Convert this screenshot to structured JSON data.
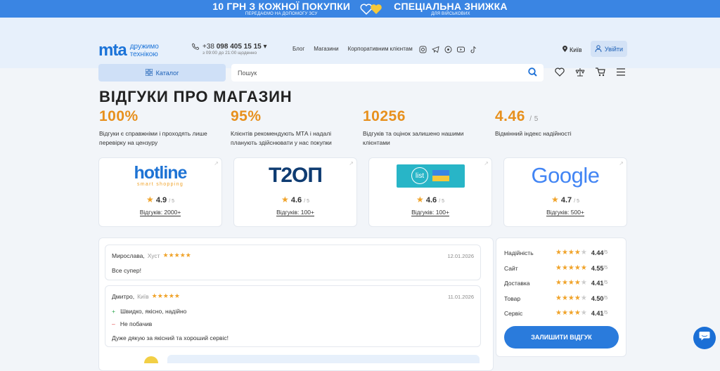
{
  "promo": {
    "left_title": "10 ГРН З КОЖНОЇ ПОКУПКИ",
    "left_sub": "ПЕРЕДАЄМО НА ДОПОМОГУ ЗСУ",
    "right_title": "СПЕЦІАЛЬНА ЗНИЖКА",
    "right_sub": "ДЛЯ ВІЙСЬКОВИХ",
    "colors": {
      "bg": "#3a85e3",
      "heart_blue": "#3a85e3",
      "heart_yellow": "#f5c83a"
    }
  },
  "header": {
    "logo_mark": "mta",
    "logo_tag_1": "дружимо",
    "logo_tag_2": "технікою",
    "phone_prefix": "+38",
    "phone_number": "098 405 15 15",
    "hours": "з 09:00 до 21:00 щоденно",
    "nav": [
      "Блог",
      "Магазини",
      "Корпоративним клієнтам"
    ],
    "socials": [
      "instagram-icon",
      "telegram-icon",
      "viber-icon",
      "youtube-icon",
      "tiktok-icon"
    ],
    "city": "Київ",
    "login": "Увійти",
    "catalog": "Каталог",
    "search_placeholder": "Пошук",
    "actions": [
      "heart-icon",
      "compare-icon",
      "cart-icon",
      "menu-icon"
    ]
  },
  "page": {
    "title": "ВІДГУКИ ПРО МАГАЗИН",
    "stats": [
      {
        "value": "100%",
        "suffix": "",
        "desc": "Відгуки є справжніми і проходять лише перевірку на цензуру"
      },
      {
        "value": "95%",
        "suffix": "",
        "desc": "Клієнтів рекомендують МТА і надалі планують здійснювати у нас покупки"
      },
      {
        "value": "10256",
        "suffix": "",
        "desc": "Відгуків та оцінок залишено нашими клієнтами"
      },
      {
        "value": "4.46",
        "suffix": "/ 5",
        "desc": "Відмінний індекс надійності"
      }
    ],
    "platforms": [
      {
        "name": "hotline",
        "logo_text": "hotline",
        "logo_sub": "smart shopping",
        "rating": "4.9",
        "of": "/ 5",
        "count_label": "Відгуків: 2000+"
      },
      {
        "name": "t2op",
        "logo_text": "Т2ОП",
        "rating": "4.6",
        "of": "/ 5",
        "count_label": "Відгуків: 100+"
      },
      {
        "name": "list",
        "logo_text": "list",
        "rating": "4.6",
        "of": "/ 5",
        "count_label": "Відгуків: 100+"
      },
      {
        "name": "google",
        "logo_text": "Google",
        "rating": "4.7",
        "of": "/ 5",
        "count_label": "Відгуків: 500+"
      }
    ],
    "reviews": [
      {
        "author": "Мирослава,",
        "city": "Хуст",
        "stars": 5,
        "date": "12.01.2026",
        "text": "Все супер!"
      },
      {
        "author": "Дмитро,",
        "city": "Київ",
        "stars": 5,
        "date": "11.01.2026",
        "plus": "Швидко, якісно, надійно",
        "minus": "Не побачив",
        "text": "Дуже дякую за якісний та хороший сервіс!"
      }
    ],
    "scores": [
      {
        "label": "Надійність",
        "value": "4.44",
        "of": "/5",
        "stars": 4.4
      },
      {
        "label": "Сайт",
        "value": "4.55",
        "of": "/5",
        "stars": 4.6
      },
      {
        "label": "Доставка",
        "value": "4.41",
        "of": "/5",
        "stars": 4.4
      },
      {
        "label": "Товар",
        "value": "4.50",
        "of": "/5",
        "stars": 4.5
      },
      {
        "label": "Сервіс",
        "value": "4.41",
        "of": "/5",
        "stars": 4.4
      }
    ],
    "leave_review": "ЗАЛИШИТИ ВІДГУК"
  }
}
